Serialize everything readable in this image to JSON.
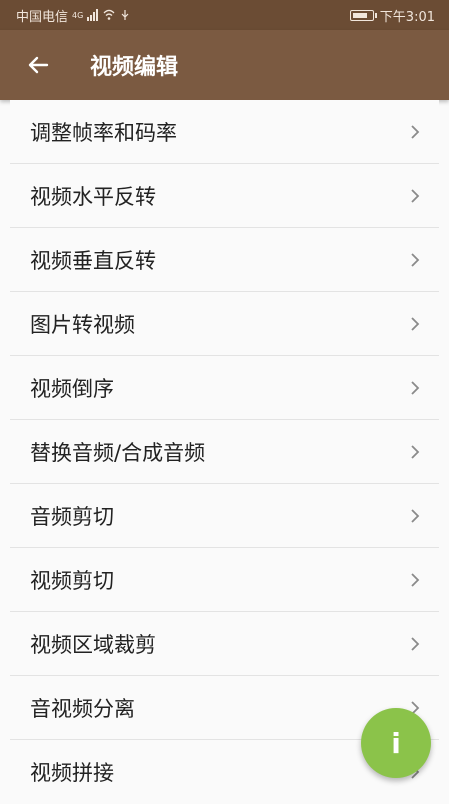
{
  "status_bar": {
    "carrier": "中国电信",
    "network": "4G",
    "time": "下午3:01"
  },
  "app_bar": {
    "title": "视频编辑",
    "back_icon": "arrow-left-icon"
  },
  "menu": {
    "items": [
      {
        "label": "调整帧率和码率"
      },
      {
        "label": "视频水平反转"
      },
      {
        "label": "视频垂直反转"
      },
      {
        "label": "图片转视频"
      },
      {
        "label": "视频倒序"
      },
      {
        "label": "替换音频/合成音频"
      },
      {
        "label": "音频剪切"
      },
      {
        "label": "视频剪切"
      },
      {
        "label": "视频区域裁剪"
      },
      {
        "label": "音视频分离"
      },
      {
        "label": "视频拼接"
      }
    ]
  },
  "fab": {
    "label": "i",
    "color": "#8bc34a"
  },
  "colors": {
    "status_bar": "#6b4c34",
    "app_bar": "#7b5a41",
    "background": "#fafafa",
    "divider": "#e3e3e3"
  }
}
